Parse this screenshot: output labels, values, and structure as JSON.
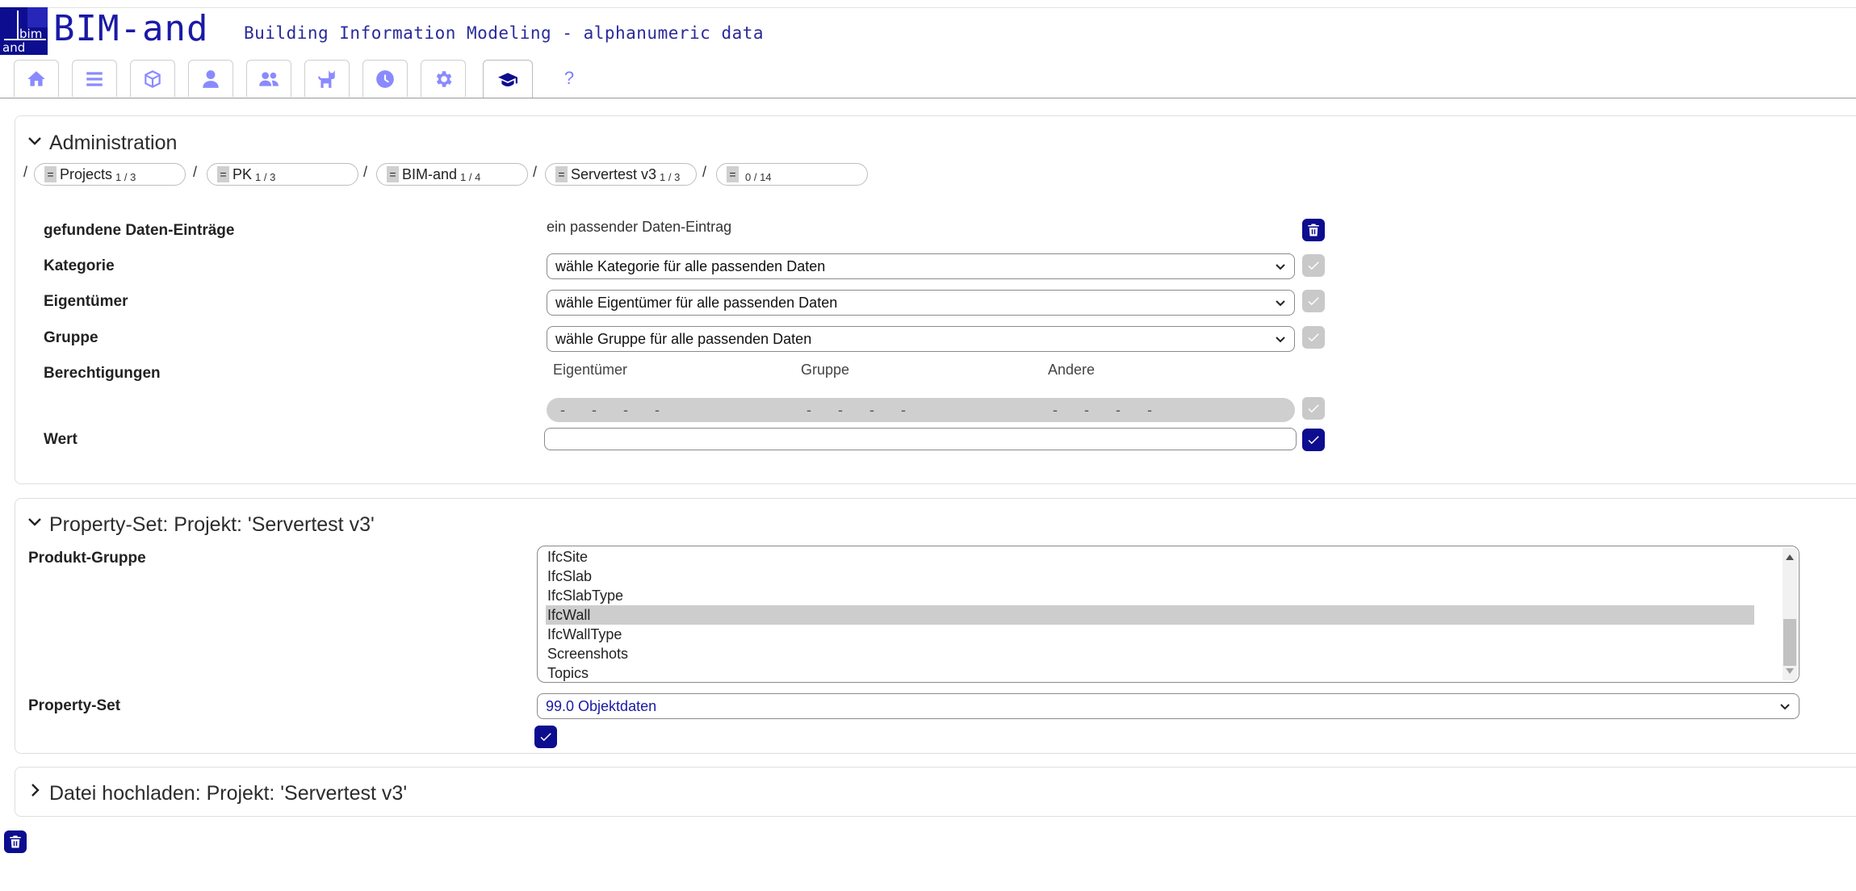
{
  "header": {
    "logo_text": "BIM-and",
    "subtitle": "Building Information Modeling - alphanumeric data",
    "logo_box_text_top": "bim",
    "logo_box_text_bottom": "and"
  },
  "tabs": [
    {
      "name": "tab-home",
      "icon": "home-icon"
    },
    {
      "name": "tab-list",
      "icon": "list-icon"
    },
    {
      "name": "tab-cube",
      "icon": "cube-icon"
    },
    {
      "name": "tab-user",
      "icon": "user-icon"
    },
    {
      "name": "tab-users",
      "icon": "users-icon"
    },
    {
      "name": "tab-cat",
      "icon": "cat-icon"
    },
    {
      "name": "tab-history",
      "icon": "clock-icon"
    },
    {
      "name": "tab-settings",
      "icon": "gear-icon"
    },
    {
      "name": "tab-admin",
      "icon": "graduation-cap-icon",
      "active": true
    },
    {
      "name": "tab-help",
      "label": "?"
    }
  ],
  "admin": {
    "title": "Administration",
    "breadcrumb": [
      {
        "label": "Projects",
        "count": "1 / 3"
      },
      {
        "label": "PK",
        "count": "1 / 3"
      },
      {
        "label": "BIM-and",
        "count": "1 / 4"
      },
      {
        "label": "Servertest v3",
        "count": "1 / 3"
      },
      {
        "label": "",
        "count": "0 / 14"
      }
    ],
    "crumb_eq": "=",
    "crumb_sep": "/",
    "found_label": "gefundene Daten-Einträge",
    "found_value": "ein passender Daten-Eintrag",
    "category_label": "Kategorie",
    "category_select": "wähle Kategorie für alle passenden Daten",
    "owner_label": "Eigentümer",
    "owner_select": "wähle Eigentümer für alle passenden Daten",
    "group_label": "Gruppe",
    "group_select": "wähle Gruppe für alle passenden Daten",
    "perm_label": "Berechtigungen",
    "perm_cols": [
      "Eigentümer",
      "Gruppe",
      "Andere"
    ],
    "perm_dashes": "- - - -",
    "value_label": "Wert",
    "value_input": ""
  },
  "propset": {
    "title": "Property-Set: Projekt: 'Servertest v3'",
    "product_group_label": "Produkt-Gruppe",
    "product_groups": [
      "IfcSite",
      "IfcSlab",
      "IfcSlabType",
      "IfcWall",
      "IfcWallType",
      "Screenshots",
      "Topics"
    ],
    "selected_group": "IfcWall",
    "property_set_label": "Property-Set",
    "property_set_select": "99.0 Objektdaten"
  },
  "upload": {
    "title": "Datei hochladen: Projekt: 'Servertest v3'"
  },
  "colors": {
    "brand": "#0d0d8f",
    "tab_icon": "#8a8aff",
    "disabled": "#c9c9c9"
  }
}
